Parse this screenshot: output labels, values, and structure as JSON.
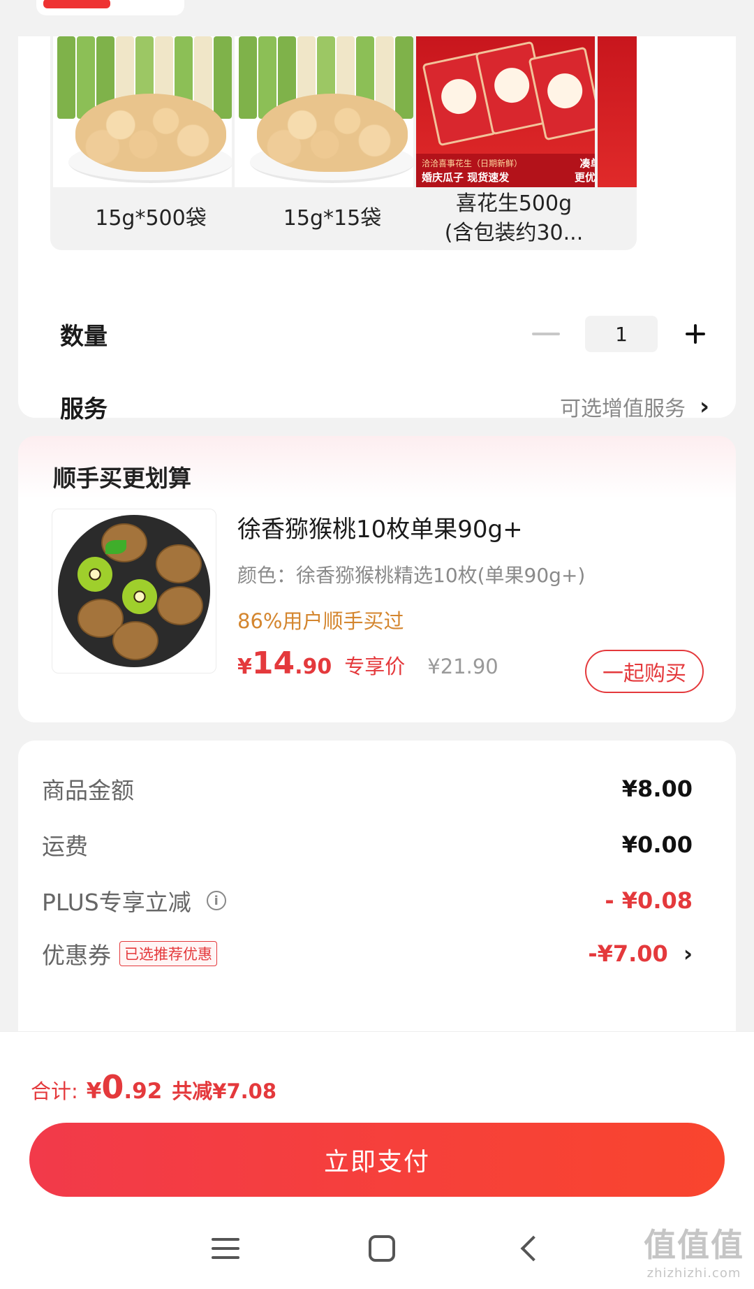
{
  "sku_options": [
    {
      "label": "15g*500袋",
      "image": "peanut-bags"
    },
    {
      "label": "15g*15袋",
      "image": "peanut-bags"
    },
    {
      "label_line1": "喜花生500g",
      "label_line2": "(含包装约30...",
      "image": "red-packs",
      "banner_line1": "洽洽喜事花生（日期新鲜）",
      "banner_line2": "婚庆瓜子 现货速发",
      "banner_tag1": "凑单",
      "banner_tag2": "更优惠"
    }
  ],
  "quantity": {
    "label": "数量",
    "value": "1"
  },
  "service": {
    "label": "服务",
    "value": "可选增值服务"
  },
  "recommend": {
    "title": "顺手买更划算",
    "product_name": "徐香猕猴桃10枚单果90g+",
    "color_text": "颜色：徐香猕猴桃精选10枚(单果90g+)",
    "bought_text": "86%用户顺手买过",
    "price_symbol": "¥",
    "price_int": "14",
    "price_dec": ".90",
    "price_tag": "专享价",
    "original_price": "¥21.90",
    "button": "一起购买"
  },
  "summary": {
    "goods_label": "商品金额",
    "goods_value": "¥8.00",
    "shipping_label": "运费",
    "shipping_value": "¥0.00",
    "plus_label": "PLUS专享立减",
    "plus_value": "- ¥0.08",
    "coupon_label": "优惠券",
    "coupon_tag": "已选推荐优惠",
    "coupon_value": "-¥7.00"
  },
  "total": {
    "label": "合计:",
    "symbol": "¥",
    "int": "0",
    "dec": ".92",
    "saved": "共减¥7.08"
  },
  "pay_button": "立即支付",
  "watermark": {
    "main": "值值值",
    "sub": "zhizhizhi.com"
  },
  "colors": {
    "accent": "#e4393c",
    "pay_gradient_start": "#f23a4a",
    "pay_gradient_end": "#f9452e",
    "bought": "#d4862f"
  }
}
